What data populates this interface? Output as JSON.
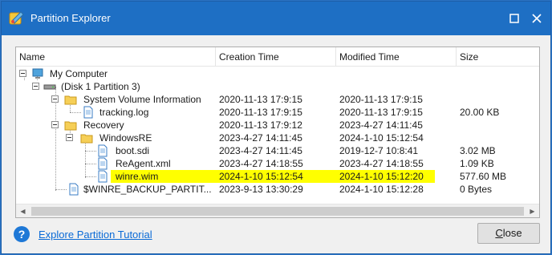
{
  "window": {
    "title": "Partition Explorer",
    "colors": {
      "titlebar": "#1e6fc4",
      "highlight": "#ffff00",
      "link": "#0a6ad6"
    }
  },
  "columns": [
    {
      "label": "Name"
    },
    {
      "label": "Creation Time"
    },
    {
      "label": "Modified Time"
    },
    {
      "label": "Size"
    }
  ],
  "tree": [
    {
      "name": "My Computer",
      "icon": "computer-icon",
      "creation": "",
      "modified": "",
      "size": ""
    },
    {
      "name": "(Disk 1 Partition 3)",
      "icon": "drive-icon",
      "creation": "",
      "modified": "",
      "size": ""
    },
    {
      "name": "System Volume Information",
      "icon": "folder-icon",
      "creation": "2020-11-13 17:9:15",
      "modified": "2020-11-13 17:9:15",
      "size": ""
    },
    {
      "name": "tracking.log",
      "icon": "file-icon",
      "creation": "2020-11-13 17:9:15",
      "modified": "2020-11-13 17:9:15",
      "size": "20.00 KB"
    },
    {
      "name": "Recovery",
      "icon": "folder-icon",
      "creation": "2020-11-13 17:9:12",
      "modified": "2023-4-27 14:11:45",
      "size": ""
    },
    {
      "name": "WindowsRE",
      "icon": "folder-icon",
      "creation": "2023-4-27 14:11:45",
      "modified": "2024-1-10 15:12:54",
      "size": ""
    },
    {
      "name": "boot.sdi",
      "icon": "file-icon",
      "creation": "2023-4-27 14:11:45",
      "modified": "2019-12-7 10:8:41",
      "size": "3.02 MB"
    },
    {
      "name": "ReAgent.xml",
      "icon": "file-icon",
      "creation": "2023-4-27 14:18:55",
      "modified": "2023-4-27 14:18:55",
      "size": "1.09 KB"
    },
    {
      "name": "winre.wim",
      "icon": "file-icon",
      "creation": "2024-1-10 15:12:54",
      "modified": "2024-1-10 15:12:20",
      "size": "577.60 MB",
      "highlighted": true
    },
    {
      "name": "$WINRE_BACKUP_PARTIT...",
      "icon": "file-icon",
      "creation": "2023-9-13 13:30:29",
      "modified": "2024-1-10 15:12:28",
      "size": "0 Bytes"
    }
  ],
  "footer": {
    "help_link": "Explore Partition Tutorial",
    "close_label_accel": "C",
    "close_label_rest": "lose"
  }
}
